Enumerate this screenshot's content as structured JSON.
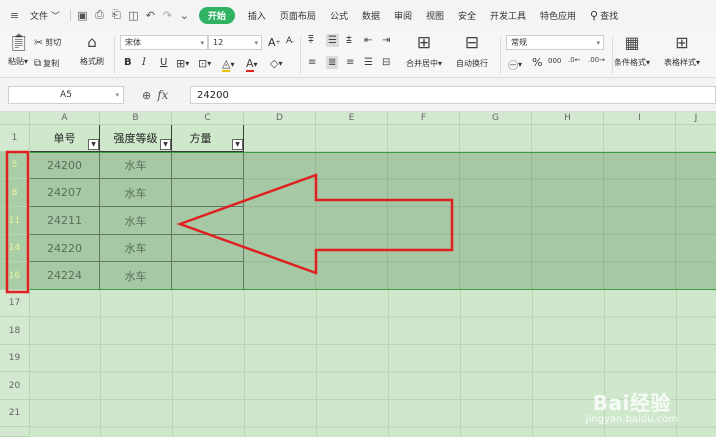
{
  "menubar": {
    "file_label": "文件",
    "tabs": [
      "开始",
      "插入",
      "页面布局",
      "公式",
      "数据",
      "审阅",
      "视图",
      "安全",
      "开发工具",
      "特色应用"
    ],
    "active_tab_index": 0,
    "search_label": "查找"
  },
  "ribbon": {
    "paste": "粘贴",
    "cut": "剪切",
    "copy": "复制",
    "format_painter": "格式刷",
    "font_name": "宋体",
    "font_size": "12",
    "bold": "B",
    "italic": "I",
    "underline": "U",
    "grow_font": "A",
    "shrink_font": "A",
    "merge_center": "合并居中",
    "wrap_text": "自动换行",
    "number_format": "常规",
    "percent": "%",
    "thousands": "000",
    "cond_format": "条件格式",
    "table_style": "表格样式"
  },
  "formula_bar": {
    "name_box": "A5",
    "fx_label": "fx",
    "value": "24200"
  },
  "columns": [
    "A",
    "B",
    "C",
    "D",
    "E",
    "F",
    "G",
    "H",
    "I",
    "J"
  ],
  "rows": [
    "1",
    "17",
    "18",
    "19",
    "20",
    "21"
  ],
  "selected_row_numbers": [
    "5",
    "8",
    "11",
    "14",
    "16"
  ],
  "header_row": [
    "单号",
    "强度等级",
    "方量"
  ],
  "data_rows": [
    [
      "24200",
      "水车",
      ""
    ],
    [
      "24207",
      "水车",
      ""
    ],
    [
      "24211",
      "水车",
      ""
    ],
    [
      "24220",
      "水车",
      ""
    ],
    [
      "24224",
      "水车",
      ""
    ]
  ],
  "watermark": {
    "line1": "Bai经验",
    "line2": "jingyan.baidu.com"
  },
  "colors": {
    "active_tab": "#2fb363",
    "annotation": "#e02020",
    "sheet_bg": "#cfe8cc"
  }
}
